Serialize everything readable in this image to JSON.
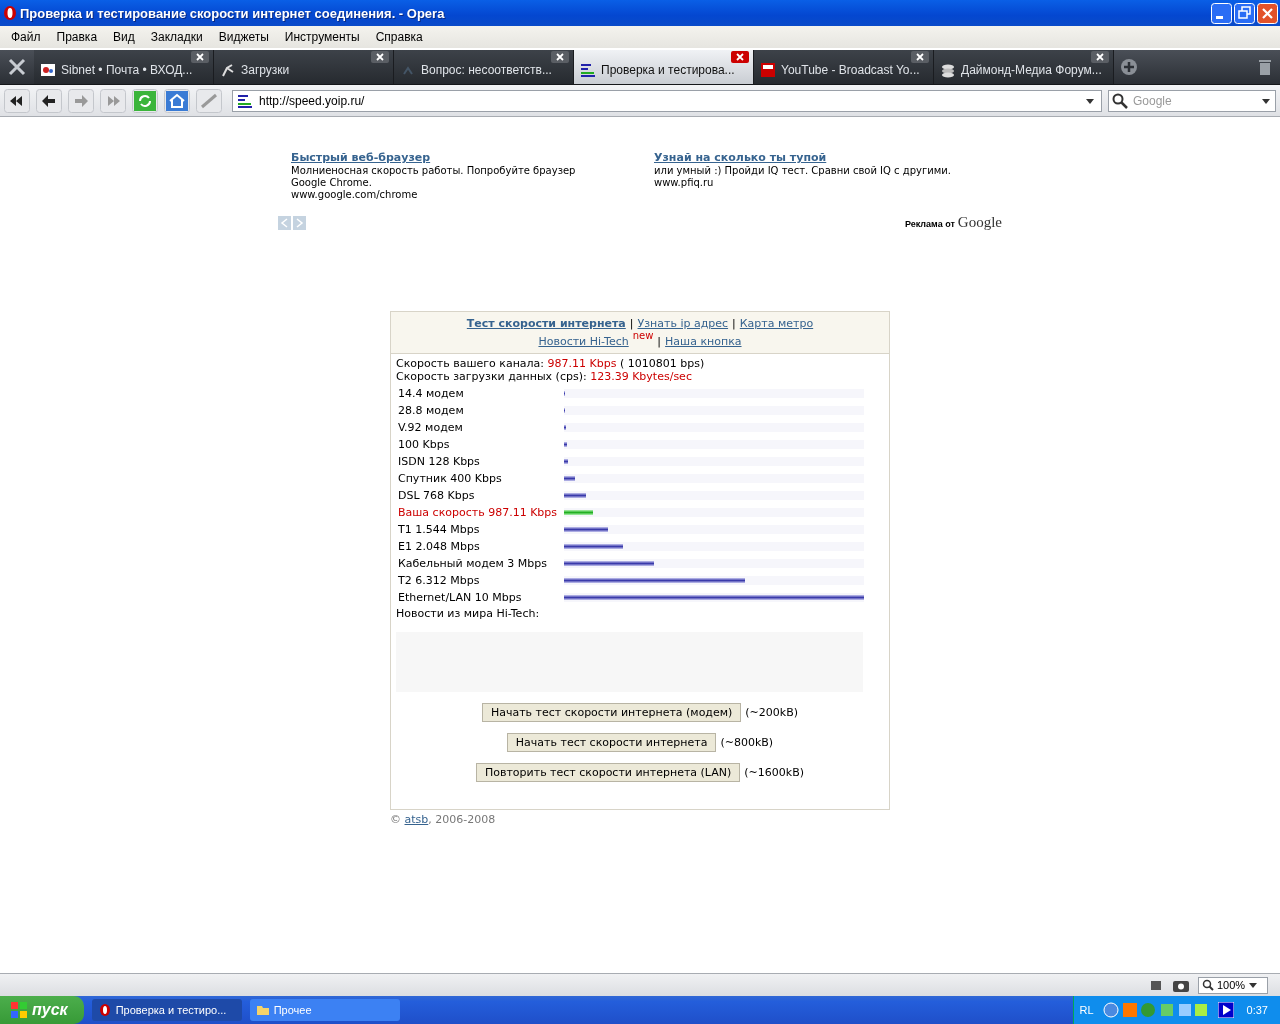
{
  "window": {
    "title": "Проверка и тестирование скорости интернет соединения. - Opera"
  },
  "menu": [
    "Файл",
    "Правка",
    "Вид",
    "Закладки",
    "Виджеты",
    "Инструменты",
    "Справка"
  ],
  "tabs": [
    {
      "label": "Sibnet • Почта • ВХОД...",
      "selected": false
    },
    {
      "label": "Загрузки",
      "selected": false
    },
    {
      "label": "Вопрос: несоответств...",
      "selected": false
    },
    {
      "label": "Проверка и тестирова...",
      "selected": true
    },
    {
      "label": "YouTube - Broadcast Yo...",
      "selected": false
    },
    {
      "label": "Даймонд-Медиа Форум...",
      "selected": false
    }
  ],
  "address_bar": {
    "url": "http://speed.yoip.ru/"
  },
  "search": {
    "placeholder": "Google"
  },
  "ads": [
    {
      "title": "Быстрый веб-браузер",
      "lines": [
        "Молниеносная скорость работы. Попробуйте браузер",
        "Google Chrome.",
        "www.google.com/chrome"
      ]
    },
    {
      "title": "Узнай на сколько ты тупой",
      "lines": [
        "или умный :) Пройди IQ тест. Сравни свой IQ с другими.",
        "www.pfiq.ru"
      ]
    }
  ],
  "ads_by": {
    "label": "Реклама от",
    "brand": "Google"
  },
  "speed_test": {
    "nav": [
      [
        {
          "label": "Тест скорости интернета",
          "selected": true
        },
        {
          "separator": "|",
          "label": "Узнать ip адрес",
          "selected": false
        },
        {
          "separator": "|",
          "label": "Карта метро",
          "selected": false
        }
      ],
      [
        {
          "label": "Новости Hi-Tech",
          "badge": "new",
          "selected": false
        },
        {
          "separator": "|",
          "label": "Наша кнопка",
          "selected": false
        }
      ]
    ],
    "results": [
      {
        "label": "Скорость вашего канала:",
        "value": "987.11 Kbps",
        "extra": "( 1010801 bps)"
      },
      {
        "label": "Скорость загрузки данных (cps):",
        "value": "123.39 Kbytes/sec"
      }
    ],
    "bars": [
      {
        "label": "14.4 модем",
        "level": 0.004,
        "highlight": false
      },
      {
        "label": "28.8 модем",
        "level": 0.004,
        "highlight": false
      },
      {
        "label": "V.92 модем",
        "level": 0.006,
        "highlight": false
      },
      {
        "label": "100 Kbps",
        "level": 0.01,
        "highlight": false
      },
      {
        "label": "ISDN 128 Kbps",
        "level": 0.013,
        "highlight": false
      },
      {
        "label": "Спутник 400 Kbps",
        "level": 0.037,
        "highlight": false
      },
      {
        "label": "DSL 768 Kbps",
        "level": 0.073,
        "highlight": false
      },
      {
        "label": "Ваша скорость 987.11 Kbps",
        "level": 0.097,
        "highlight": true
      },
      {
        "label": "T1 1.544 Mbps",
        "level": 0.147,
        "highlight": false
      },
      {
        "label": "E1 2.048 Mbps",
        "level": 0.197,
        "highlight": false
      },
      {
        "label": "Кабельный модем 3 Mbps",
        "level": 0.3,
        "highlight": false
      },
      {
        "label": "T2 6.312 Mbps",
        "level": 0.603,
        "highlight": false
      },
      {
        "label": "Ethernet/LAN 10 Mbps",
        "level": 1,
        "highlight": false
      }
    ],
    "news_heading": "Новости из мира Hi-Tech:",
    "buttons": [
      {
        "label": "Начать тест скорости интернета (модем)",
        "note": "(~200kB)"
      },
      {
        "label": "Начать тест скорости интернета",
        "note": "(~800kB)"
      },
      {
        "label": "Повторить тест скорости интернета (LAN)",
        "note": "(~1600kB)"
      }
    ]
  },
  "footer": {
    "copyright": "©",
    "link": "atsb",
    "years": ", 2006-2008"
  },
  "status_bar": {
    "zoom": "100%"
  },
  "taskbar": {
    "start": "пуск",
    "tasks": [
      {
        "label": "Проверка и тестиро...",
        "selected": true
      },
      {
        "label": "Прочее",
        "selected": false
      }
    ],
    "language": "RL",
    "clock": "0:37"
  }
}
